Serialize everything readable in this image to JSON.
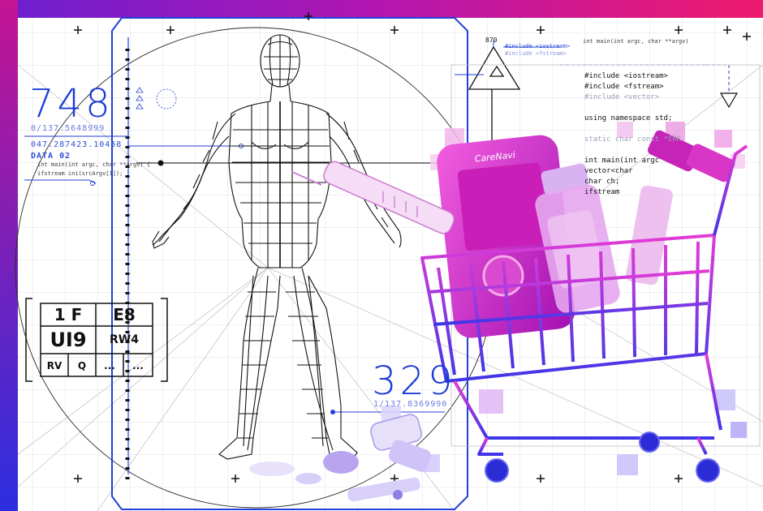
{
  "colors": {
    "accent_blue": "#1a3bd6",
    "gradient_top": "#d21a8c",
    "gradient_bottom": "#2b26d8",
    "magenta": "#d62ad0",
    "purple": "#7a3cf0"
  },
  "readout_left": {
    "value": "748",
    "sub": "0/137.5648999"
  },
  "readout_bottom": {
    "value": "329",
    "sub": "1/137.8369990"
  },
  "data_panel": {
    "coords": "047.287423.10458",
    "label": "DATA 02",
    "line1": "int main(int argc, char **argv) {",
    "line2": "ifstream ini(srcArgv[1]);"
  },
  "top_marker": {
    "value": "870",
    "line1": "#include <iostream>",
    "line2": "#include <fstream>"
  },
  "top_right_note": "int main(int argc, char **argv)",
  "code_block": {
    "lines": [
      "#include <iostream>",
      "#include <fstream>",
      "#include <vector>",
      "",
      "using namespace std;",
      "",
      "static char const *ERR",
      "",
      "int main(int argc",
      "    vector<char",
      "    char ch;",
      "    ifstream"
    ]
  },
  "label_grid": {
    "cells": [
      "1 F",
      "E8",
      "UI9",
      "RW4",
      "RV",
      "Q",
      "...",
      "..."
    ]
  },
  "device": {
    "brand": "CareNavi"
  },
  "icons": [
    "human-wireframe",
    "shopping-cart",
    "syringe",
    "insulin-vial",
    "glucose-meter",
    "pills",
    "triangle-marker",
    "crosshair"
  ]
}
